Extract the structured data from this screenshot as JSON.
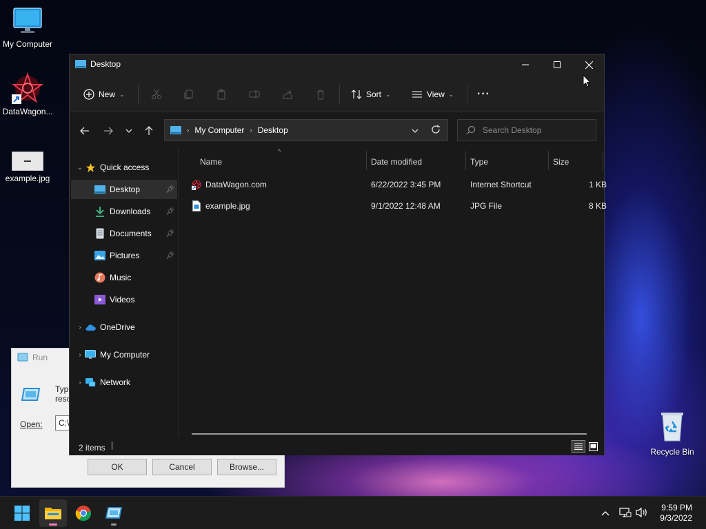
{
  "desktop": {
    "icons": [
      {
        "label": "My Computer"
      },
      {
        "label": "DataWagon..."
      },
      {
        "label": "example.jpg"
      },
      {
        "label": "Recycle Bin"
      }
    ]
  },
  "run_dialog": {
    "title": "Run",
    "description_line1": "Type",
    "description_line2": "reso",
    "open_label": "Open:",
    "input_value": "C:\\",
    "ok_label": "OK",
    "cancel_label": "Cancel",
    "browse_label": "Browse..."
  },
  "explorer": {
    "title": "Desktop",
    "toolbar": {
      "new_label": "New",
      "sort_label": "Sort",
      "view_label": "View",
      "more_label": "···"
    },
    "address": {
      "segments": [
        "My Computer",
        "Desktop"
      ]
    },
    "search": {
      "placeholder": "Search Desktop"
    },
    "sidebar": {
      "quick_access": "Quick access",
      "items": [
        {
          "label": "Desktop",
          "pinned": true,
          "selected": true
        },
        {
          "label": "Downloads",
          "pinned": true
        },
        {
          "label": "Documents",
          "pinned": true
        },
        {
          "label": "Pictures",
          "pinned": true
        },
        {
          "label": "Music"
        },
        {
          "label": "Videos"
        }
      ],
      "onedrive": "OneDrive",
      "my_computer": "My Computer",
      "network": "Network"
    },
    "columns": {
      "name": "Name",
      "date": "Date modified",
      "type": "Type",
      "size": "Size"
    },
    "files": [
      {
        "name": "DataWagon.com",
        "date": "6/22/2022 3:45 PM",
        "type": "Internet Shortcut",
        "size": "1 KB"
      },
      {
        "name": "example.jpg",
        "date": "9/1/2022 12:48 AM",
        "type": "JPG File",
        "size": "8 KB"
      }
    ],
    "status": {
      "count": "2 items"
    }
  },
  "taskbar": {
    "time": "9:59 PM",
    "date": "9/3/2022"
  }
}
